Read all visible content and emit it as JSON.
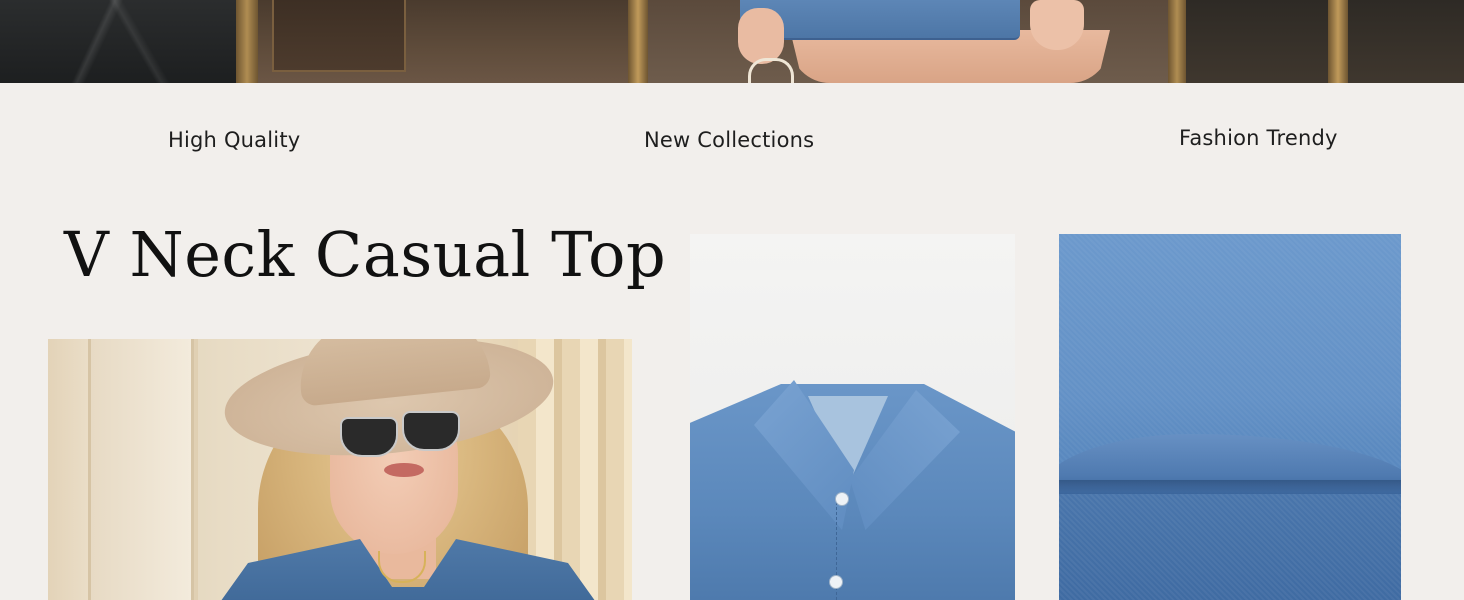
{
  "features": {
    "high_quality": "High Quality",
    "new_collections": "New Collections",
    "fashion_trendy": "Fashion Trendy"
  },
  "product": {
    "title": "V Neck Casual Top"
  },
  "colors": {
    "background": "#f2efec",
    "denim": "#5b88bb",
    "text": "#1e1e1e"
  }
}
